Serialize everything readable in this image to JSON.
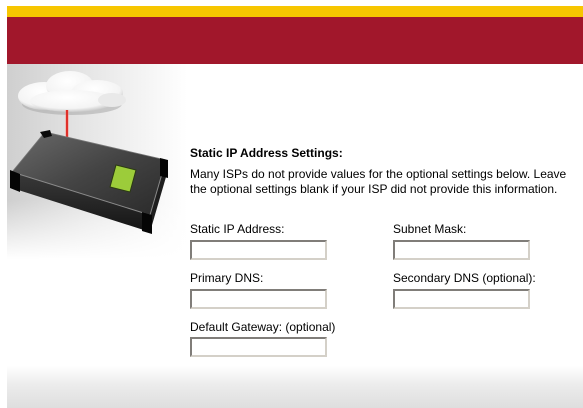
{
  "colors": {
    "top_stripe": "#f7c600",
    "banner": "#a1172b",
    "signal_beam": "#e0302a",
    "router_display": "#9ccc3a"
  },
  "illustration": {
    "cloud_icon": "cloud-icon",
    "router_icon": "router-icon"
  },
  "section": {
    "title": "Static IP Address Settings:",
    "description": "Many ISPs do not provide values for the optional settings below. Leave the optional settings blank if your ISP did not provide this information."
  },
  "fields": {
    "static_ip": {
      "label": "Static IP Address:",
      "value": ""
    },
    "subnet_mask": {
      "label": "Subnet Mask:",
      "value": ""
    },
    "primary_dns": {
      "label": "Primary DNS:",
      "value": ""
    },
    "secondary_dns": {
      "label": "Secondary DNS (optional):",
      "value": ""
    },
    "default_gateway": {
      "label": "Default Gateway: (optional)",
      "value": ""
    }
  }
}
